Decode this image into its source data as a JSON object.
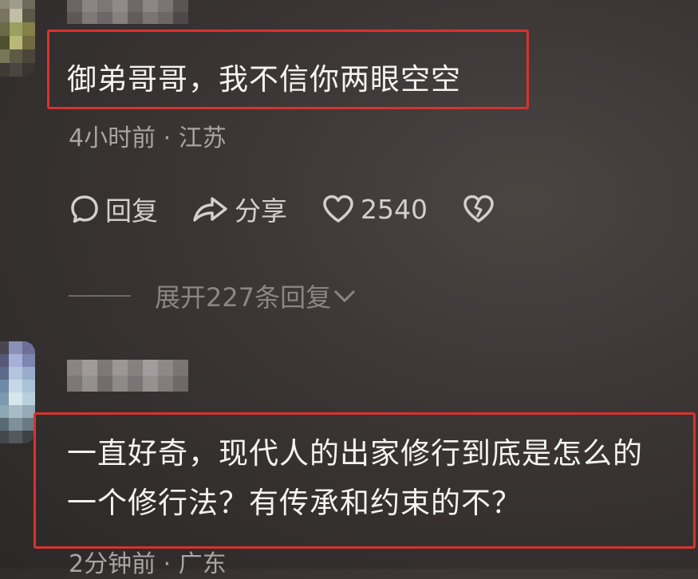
{
  "comments": [
    {
      "text": "御弟哥哥，我不信你两眼空空",
      "meta": "4小时前 · 江苏",
      "actions": {
        "reply_label": "回复",
        "share_label": "分享",
        "like_count": "2540"
      },
      "expand_label": "展开227条回复"
    },
    {
      "text_line1": "一直好奇，现代人的出家修行到底是怎么的",
      "text_line2": "一个修行法？有传承和约束的不？",
      "meta": "2分钟前 · 广东"
    }
  ],
  "colors": {
    "highlight": "#d9322f",
    "background": "#3a3534",
    "text": "#f4f4f4",
    "meta": "#a9a5a4"
  },
  "icons": [
    "reply-bubble-icon",
    "share-arrow-icon",
    "heart-icon",
    "broken-heart-icon",
    "chevron-down-icon"
  ]
}
